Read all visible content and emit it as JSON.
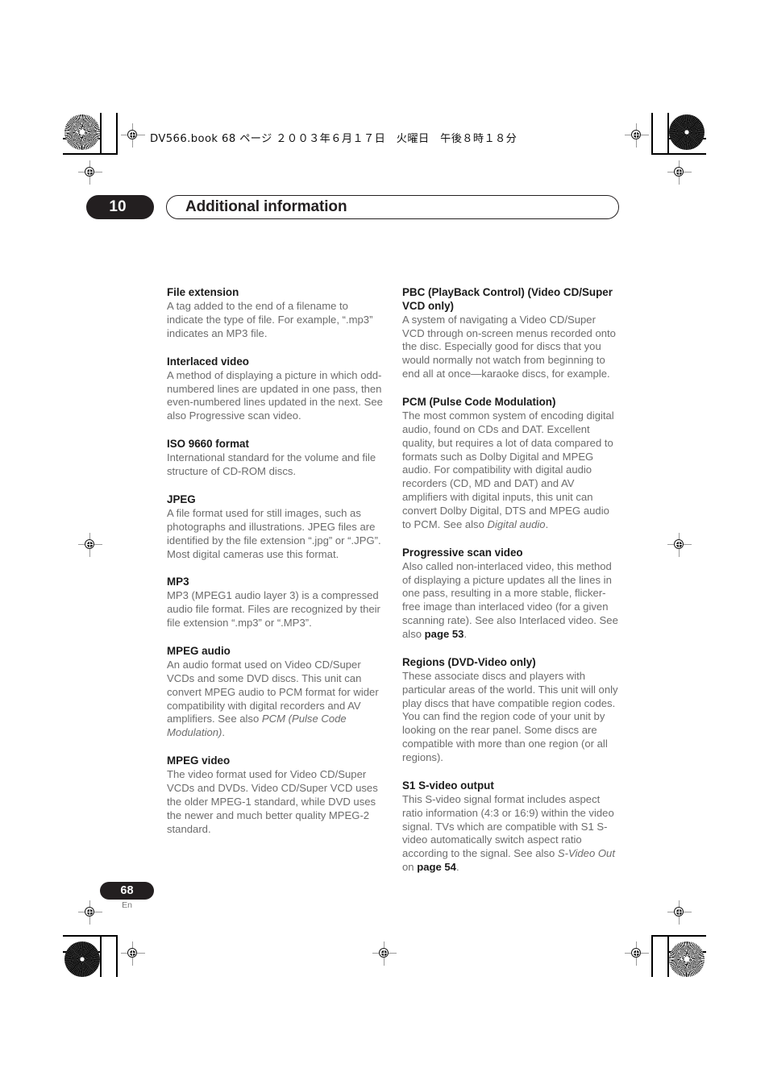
{
  "book_header": "DV566.book  68 ページ  ２００３年６月１７日　火曜日　午後８時１８分",
  "chapter": {
    "number": "10",
    "title": "Additional information"
  },
  "footer": {
    "page_number": "68",
    "language": "En"
  },
  "columns": {
    "left": [
      {
        "term": "File extension",
        "definition": "A tag added to the end of a filename to indicate the type of file. For example, “.mp3” indicates an MP3 file."
      },
      {
        "term": "Interlaced video",
        "definition": "A method of displaying a picture in which odd-numbered lines are updated in one pass, then even-numbered lines updated in the next. See also Progressive scan video."
      },
      {
        "term": "ISO 9660 format",
        "definition": "International standard for the volume and file structure of CD-ROM discs."
      },
      {
        "term": "JPEG",
        "definition": "A file format used for still images, such as photographs and illustrations. JPEG files are identified by the file extension “.jpg” or “.JPG”. Most digital cameras use this format."
      },
      {
        "term": "MP3",
        "definition": "MP3 (MPEG1 audio layer 3) is a compressed audio file format. Files are recognized by their file extension “.mp3” or “.MP3”."
      },
      {
        "term": "MPEG audio",
        "definition_html": "An audio format used on Video CD/Super VCDs and some DVD discs. This unit can convert MPEG audio to PCM format for wider compatibility with digital recorders and AV amplifiers. See also <i>PCM (Pulse Code Modulation)</i>."
      },
      {
        "term": "MPEG video",
        "definition": "The video format used for Video CD/Super VCDs and DVDs. Video CD/Super VCD uses the older MPEG-1 standard, while DVD uses the newer and much better quality MPEG-2 standard."
      }
    ],
    "right": [
      {
        "term": "PBC (PlayBack Control) (Video CD/Super VCD only)",
        "definition": "A system of navigating a Video CD/Super VCD through on-screen menus recorded onto the disc. Especially good for discs that you would normally not watch from beginning to end all at once—karaoke discs, for example."
      },
      {
        "term": "PCM (Pulse Code Modulation)",
        "definition_html": "The most common system of encoding digital audio, found on CDs and DAT. Excellent quality, but requires a lot of data compared to formats such as Dolby Digital and MPEG audio. For compatibility with digital audio recorders (CD, MD and DAT) and AV amplifiers with digital inputs, this unit can convert Dolby Digital, DTS and MPEG audio to PCM. See also <i>Digital audio</i>."
      },
      {
        "term": "Progressive scan video",
        "definition_html": "Also called non-interlaced video, this method of displaying a picture updates all the lines in one pass, resulting in a more stable, flicker-free image than interlaced video (for a given scanning rate). See also Interlaced video. See also <b>page 53</b>."
      },
      {
        "term": "Regions (DVD-Video only)",
        "definition": "These associate discs and players with particular areas of the world. This unit will only play discs that have compatible region codes. You can find the region code of your unit by looking on the rear panel. Some discs are compatible with more than one region (or all regions)."
      },
      {
        "term": "S1 S-video output",
        "definition_html": "This S-video signal format includes aspect ratio information (4:3 or 16:9) within the video signal. TVs which are compatible with S1 S-video automatically switch aspect ratio according to the signal. See also <i>S-Video Out</i> on <b>page 54</b>."
      }
    ]
  },
  "colors": {
    "ink": "#231f20",
    "body_text": "#6c6c6c",
    "heading_text": "#1a1a1a"
  }
}
